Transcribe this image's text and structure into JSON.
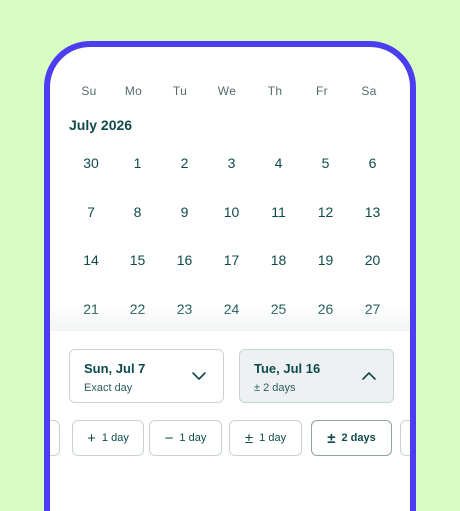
{
  "weekdays": [
    "Su",
    "Mo",
    "Tu",
    "We",
    "Th",
    "Fr",
    "Sa"
  ],
  "month_label": "July 2026",
  "calendar_days": [
    "30",
    "1",
    "2",
    "3",
    "4",
    "5",
    "6",
    "7",
    "8",
    "9",
    "10",
    "11",
    "12",
    "13",
    "14",
    "15",
    "16",
    "17",
    "18",
    "19",
    "20",
    "21",
    "22",
    "23",
    "24",
    "25",
    "26",
    "27"
  ],
  "start_date": {
    "label": "Sun, Jul 7",
    "flex": "Exact day",
    "icon": "chevron-down-icon"
  },
  "end_date": {
    "label": "Tue, Jul 16",
    "flex": "± 2 days",
    "icon": "chevron-up-icon"
  },
  "flex_options": [
    {
      "symbol": "+",
      "label": "1 day"
    },
    {
      "symbol": "−",
      "label": "1 day"
    },
    {
      "symbol": "±",
      "label": "1 day"
    },
    {
      "symbol": "±",
      "label": "2 days",
      "selected": true
    }
  ],
  "colors": {
    "background": "#d8fdc2",
    "phone_frame": "#4d3df0",
    "text": "#0f4a4a",
    "selected_card": "#eef1f3"
  }
}
